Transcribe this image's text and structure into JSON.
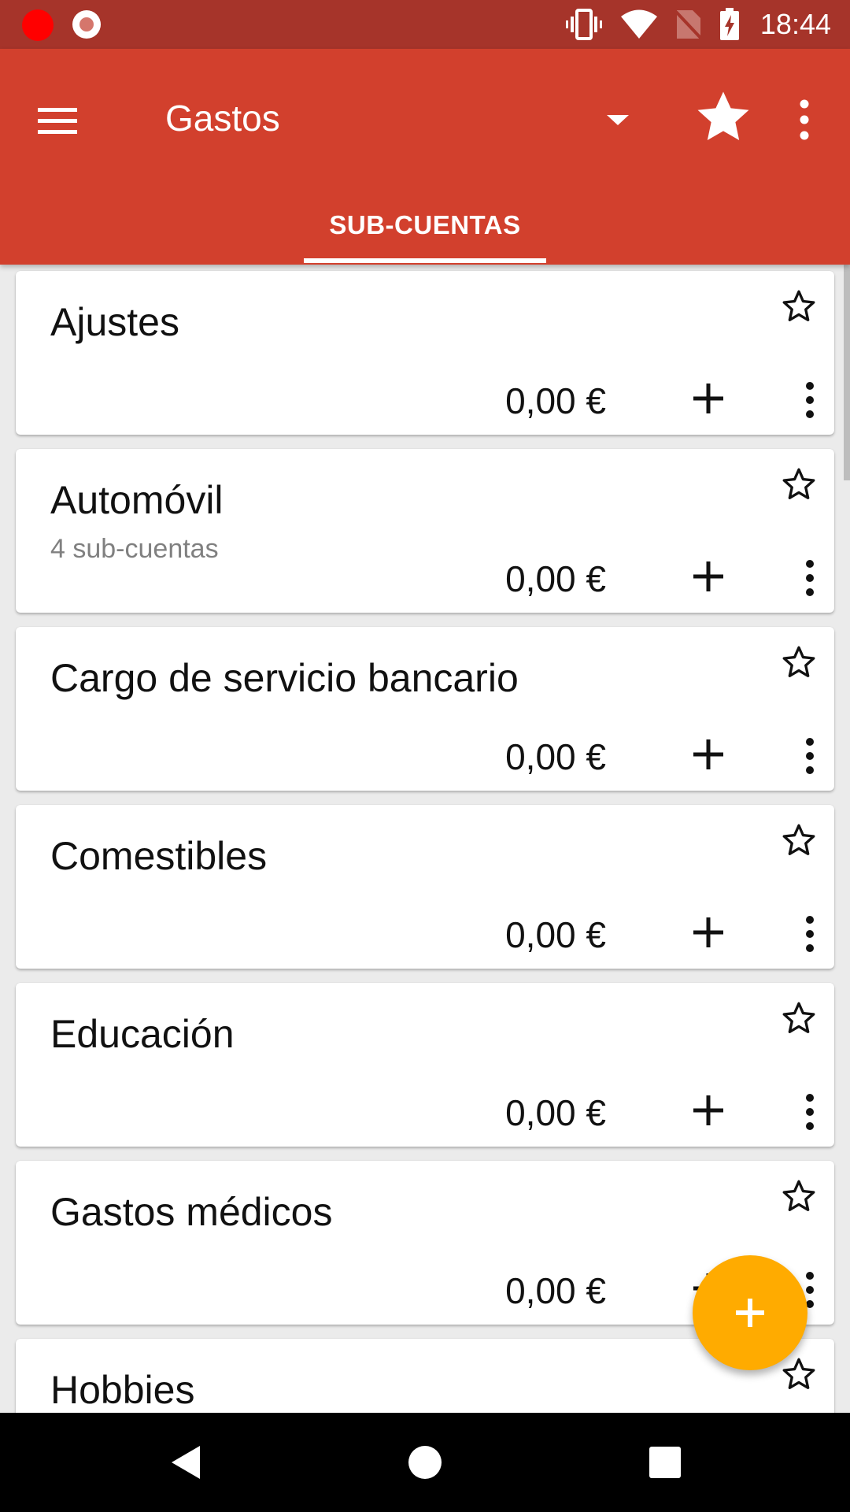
{
  "status": {
    "time": "18:44"
  },
  "appbar": {
    "title": "Gastos"
  },
  "tabs": [
    {
      "label": "SUB-CUENTAS"
    }
  ],
  "accounts": [
    {
      "name": "Ajustes",
      "subtitle": "",
      "amount": "0,00 €"
    },
    {
      "name": "Automóvil",
      "subtitle": "4 sub-cuentas",
      "amount": "0,00 €"
    },
    {
      "name": "Cargo de servicio bancario",
      "subtitle": "",
      "amount": "0,00 €"
    },
    {
      "name": "Comestibles",
      "subtitle": "",
      "amount": "0,00 €"
    },
    {
      "name": "Educación",
      "subtitle": "",
      "amount": "0,00 €"
    },
    {
      "name": "Gastos médicos",
      "subtitle": "",
      "amount": "0,00 €"
    },
    {
      "name": "Hobbies",
      "subtitle": "",
      "amount": ""
    }
  ],
  "colors": {
    "status_bar": "#a6342a",
    "app_bar": "#d2402d",
    "fab": "#ffab00",
    "background": "#ebebeb"
  },
  "icons": {
    "status": [
      "record-dot-icon",
      "record-ring-icon",
      "vibrate-icon",
      "wifi-icon",
      "no-sim-icon",
      "battery-charging-icon"
    ],
    "appbar": [
      "menu-icon",
      "dropdown-arrow-icon",
      "star-icon",
      "overflow-menu-icon"
    ],
    "card": [
      "star-outline-icon",
      "plus-icon",
      "overflow-menu-icon"
    ],
    "fab": "plus-icon",
    "nav": [
      "back-icon",
      "home-icon",
      "recents-icon"
    ]
  }
}
